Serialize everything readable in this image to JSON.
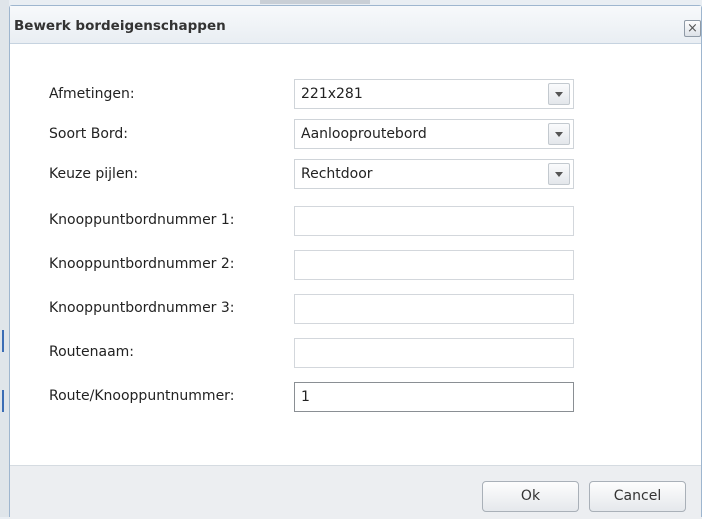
{
  "dialog": {
    "title": "Bewerk bordeigenschappen",
    "close_glyph": "×"
  },
  "form": {
    "dimensions": {
      "label": "Afmetingen:",
      "value": "221x281"
    },
    "sign_type": {
      "label": "Soort Bord:",
      "value": "Aanlooproutebord"
    },
    "arrows": {
      "label": "Keuze pijlen:",
      "value": "Rechtdoor"
    },
    "node_number_1": {
      "label": "Knooppuntbordnummer 1:",
      "value": ""
    },
    "node_number_2": {
      "label": "Knooppuntbordnummer 2:",
      "value": ""
    },
    "node_number_3": {
      "label": "Knooppuntbordnummer 3:",
      "value": ""
    },
    "route_name": {
      "label": "Routenaam:",
      "value": ""
    },
    "route_node_number": {
      "label": "Route/Knooppuntnummer:",
      "value": "1"
    }
  },
  "buttons": {
    "ok": "Ok",
    "cancel": "Cancel"
  }
}
